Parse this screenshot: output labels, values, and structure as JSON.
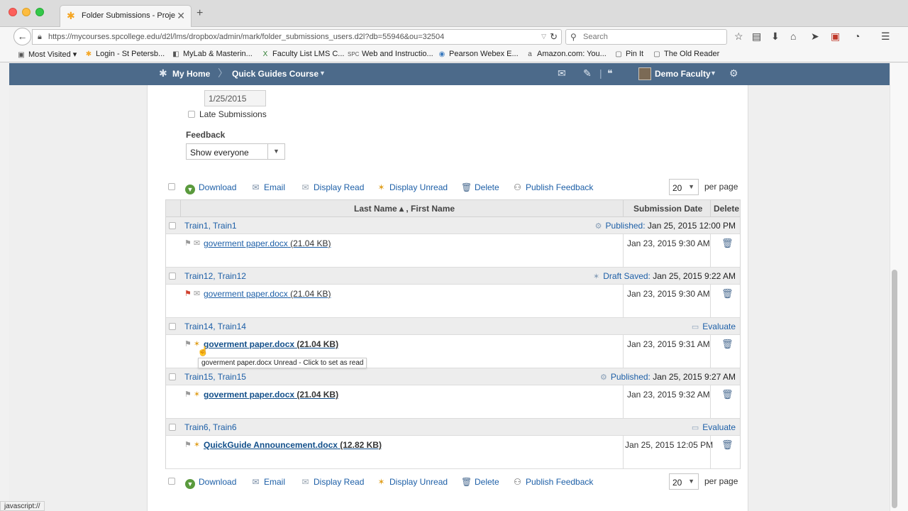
{
  "browser": {
    "tab_title": "Folder Submissions - Proje...",
    "tab_icon": "d2l-asterisk-icon",
    "url": "https://mycourses.spcollege.edu/d2l/lms/dropbox/admin/mark/folder_submissions_users.d2l?db=55946&ou=32504",
    "search_placeholder": "Search",
    "bookmarks": [
      {
        "label": "Most Visited ▾",
        "icon": "▣"
      },
      {
        "label": "Login - St Petersb...",
        "icon": "✱"
      },
      {
        "label": "MyLab & Masterin...",
        "icon": "◧"
      },
      {
        "label": "Faculty List LMS C...",
        "icon": "X"
      },
      {
        "label": "Web and Instructio...",
        "icon": "SPC"
      },
      {
        "label": "Pearson Webex E...",
        "icon": "◉"
      },
      {
        "label": "Amazon.com: You...",
        "icon": "a"
      },
      {
        "label": "Pin It",
        "icon": "▢"
      },
      {
        "label": "The Old Reader",
        "icon": "▢"
      }
    ],
    "status_text": "javascript://"
  },
  "d2l_nav": {
    "home": "My Home",
    "course": "Quick Guides Course",
    "user": "Demo Faculty"
  },
  "filters": {
    "date_value": "1/25/2015",
    "late_label": "Late Submissions",
    "feedback_heading": "Feedback",
    "feedback_select": "Show everyone"
  },
  "actions": {
    "download": "Download",
    "email": "Email",
    "display_read": "Display Read",
    "display_unread": "Display Unread",
    "delete": "Delete",
    "publish_feedback": "Publish Feedback",
    "per_page_value": "20",
    "per_page_label": "per page"
  },
  "table": {
    "headers": {
      "name": "Last Name ▴ , First Name",
      "date": "Submission Date",
      "delete": "Delete"
    },
    "rows": [
      {
        "student": "Train1, Train1",
        "status_label": "Published:",
        "status_date": "Jan 25, 2015 12:00 PM",
        "file": "goverment paper.docx",
        "size": "(21.04 KB)",
        "submitted": "Jan 23, 2015 9:30 AM"
      },
      {
        "student": "Train12, Train12",
        "status_label": "Draft Saved:",
        "status_date": "Jan 25, 2015 9:22 AM",
        "file": "goverment paper.docx",
        "size": "(21.04 KB)",
        "submitted": "Jan 23, 2015 9:30 AM"
      },
      {
        "student": "Train14, Train14",
        "status_label": "Evaluate",
        "status_date": "",
        "file": "goverment paper.docx",
        "size": "(21.04 KB)",
        "submitted": "Jan 23, 2015 9:31 AM"
      },
      {
        "student": "Train15, Train15",
        "status_label": "Published:",
        "status_date": "Jan 25, 2015 9:27 AM",
        "file": "goverment paper.docx",
        "size": "(21.04 KB)",
        "submitted": "Jan 23, 2015 9:32 AM"
      },
      {
        "student": "Train6, Train6",
        "status_label": "Evaluate",
        "status_date": "",
        "file": "QuickGuide Announcement.docx",
        "size": "(12.82 KB)",
        "submitted": "Jan 25, 2015 12:05 PM"
      }
    ]
  },
  "tooltip": "goverment paper.docx Unread - Click to set as read",
  "colors": {
    "nav_bar": "#4c6a8a",
    "link": "#1d5fa7",
    "download_green": "#5a9a3d",
    "flag_red": "#d0422f"
  }
}
